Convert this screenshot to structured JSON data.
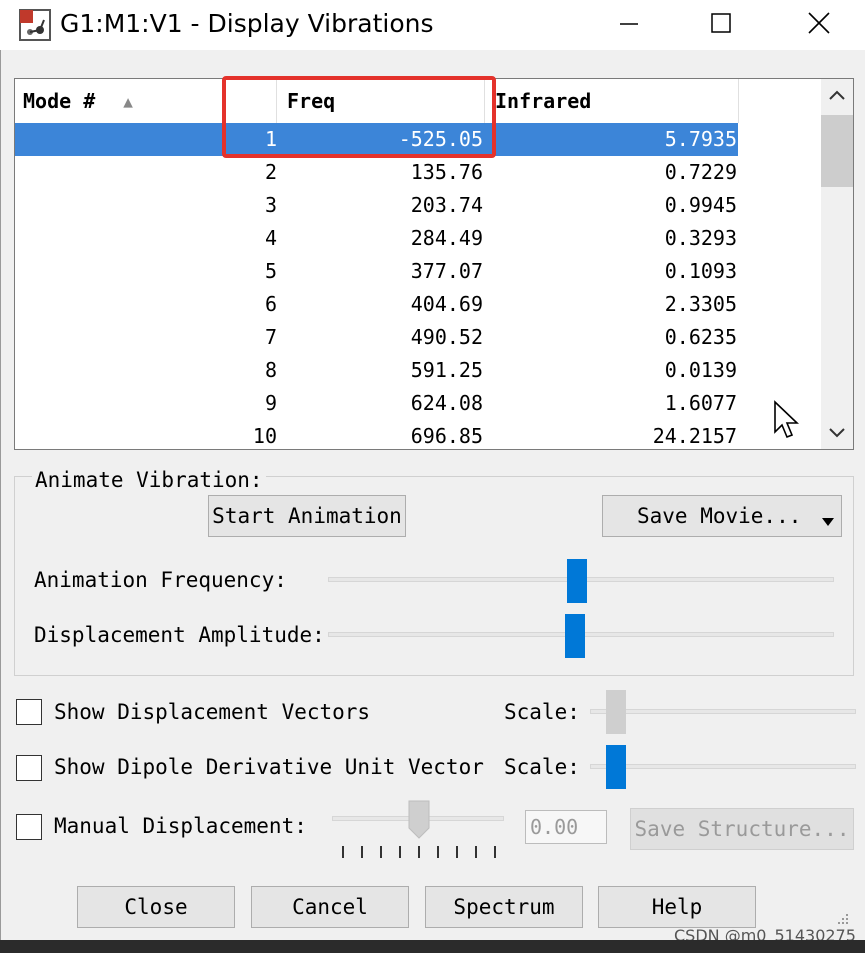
{
  "window": {
    "title": "G1:M1:V1 - Display Vibrations",
    "minimize_glyph": "—",
    "maximize_glyph": "☐",
    "close_glyph": "✕"
  },
  "list": {
    "columns": [
      "Mode #",
      "Freq",
      "Infrared"
    ],
    "sort_indicator": "▲",
    "rows": [
      {
        "mode": "1",
        "freq": "-525.05",
        "ir": "5.7935",
        "selected": true
      },
      {
        "mode": "2",
        "freq": "135.76",
        "ir": "0.7229"
      },
      {
        "mode": "3",
        "freq": "203.74",
        "ir": "0.9945"
      },
      {
        "mode": "4",
        "freq": "284.49",
        "ir": "0.3293"
      },
      {
        "mode": "5",
        "freq": "377.07",
        "ir": "0.1093"
      },
      {
        "mode": "6",
        "freq": "404.69",
        "ir": "2.3305"
      },
      {
        "mode": "7",
        "freq": "490.52",
        "ir": "0.6235"
      },
      {
        "mode": "8",
        "freq": "591.25",
        "ir": "0.0139"
      },
      {
        "mode": "9",
        "freq": "624.08",
        "ir": "1.6077"
      },
      {
        "mode": "10",
        "freq": "696.85",
        "ir": "24.2157"
      }
    ]
  },
  "animate": {
    "group_label": "Animate Vibration:",
    "start_button": "Start Animation",
    "save_movie_button": "Save Movie...",
    "frequency_label": "Animation Frequency:",
    "frequency_level": 0.5,
    "amplitude_label": "Displacement Amplitude:",
    "amplitude_level": 0.49
  },
  "options": {
    "show_vectors": "Show Displacement Vectors",
    "show_vectors_scale": "Scale:",
    "show_vectors_level": 0.05,
    "show_dipole": "Show Dipole Derivative Unit Vector",
    "show_dipole_scale": "Scale:",
    "show_dipole_level": 0.1,
    "manual_displacement": "Manual Displacement:",
    "manual_level": 0.5,
    "manual_value": "0.00",
    "save_structure_button": "Save Structure..."
  },
  "buttons": {
    "close": "Close",
    "cancel": "Cancel",
    "spectrum": "Spectrum",
    "help": "Help"
  },
  "watermark": "CSDN @m0_51430275",
  "colors": {
    "selection": "#3c85d8",
    "highlight_box": "#e4322b",
    "slider_thumb": "#0078d7"
  }
}
